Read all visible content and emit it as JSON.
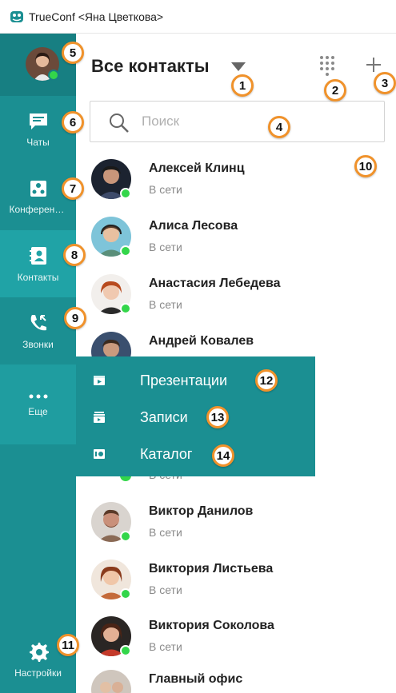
{
  "window": {
    "title": "TrueConf <Яна Цветкова>"
  },
  "sidebar": {
    "items": [
      {
        "label": "Чаты",
        "icon": "chat-icon"
      },
      {
        "label": "Конференции",
        "icon": "conference-icon"
      },
      {
        "label": "Контакты",
        "icon": "contacts-icon"
      },
      {
        "label": "Звонки",
        "icon": "calls-icon"
      },
      {
        "label": "Еще",
        "icon": "more-icon"
      }
    ],
    "settings_label": "Настройки"
  },
  "header": {
    "title": "Все контакты"
  },
  "search": {
    "placeholder": "Поиск",
    "value": ""
  },
  "contacts": [
    {
      "name": "Алексей Клинц",
      "status": "В сети"
    },
    {
      "name": "Алиса Лесова",
      "status": "В сети"
    },
    {
      "name": "Анастасия Лебедева",
      "status": "В сети"
    },
    {
      "name": "Андрей Ковалев",
      "status": ""
    },
    {
      "name": "Виктор Данилов",
      "status": "В сети"
    },
    {
      "name": "Виктория Листьева",
      "status": "В сети"
    },
    {
      "name": "Виктория Соколова",
      "status": "В сети"
    },
    {
      "name": "Главный офис",
      "status": ""
    }
  ],
  "hidden_status": "В сети",
  "popup": {
    "items": [
      {
        "label": "Презентации",
        "icon": "presentation-icon"
      },
      {
        "label": "Записи",
        "icon": "recordings-icon"
      },
      {
        "label": "Каталог",
        "icon": "catalog-icon"
      }
    ]
  },
  "badges": [
    "1",
    "2",
    "3",
    "4",
    "5",
    "6",
    "7",
    "8",
    "9",
    "10",
    "11",
    "12",
    "13",
    "14"
  ],
  "colors": {
    "sidebar": "#1b8f92",
    "active": "#20a3a6",
    "online": "#33d64a",
    "badge_border": "#f0922b"
  }
}
